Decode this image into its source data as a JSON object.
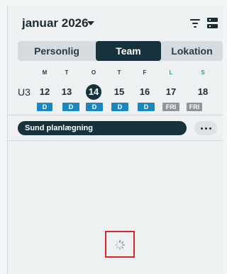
{
  "header": {
    "month_label": "januar 2026"
  },
  "view_tabs": [
    {
      "label": "Personlig",
      "active": false
    },
    {
      "label": "Team",
      "active": true
    },
    {
      "label": "Lokation",
      "active": false
    }
  ],
  "week": {
    "label": "U3",
    "day_names": [
      "M",
      "T",
      "O",
      "T",
      "F",
      "L",
      "S"
    ],
    "dates": [
      "12",
      "13",
      "14",
      "15",
      "16",
      "17",
      "18"
    ],
    "today_index": 2,
    "shifts": [
      "D",
      "D",
      "D",
      "D",
      "D",
      "FRI",
      "FRI"
    ]
  },
  "plan": {
    "label": "Sund planlægning",
    "more_label": "..."
  },
  "colors": {
    "primary": "#15323d",
    "shift_day": "#1b87ba",
    "shift_free": "#8f959a",
    "weekend_text": "#2a9d8f",
    "highlight_box": "#d9262c"
  },
  "icons": {
    "filter": "filter-icon",
    "layout": "layout-icon",
    "loading": "loading-spinner-icon"
  }
}
